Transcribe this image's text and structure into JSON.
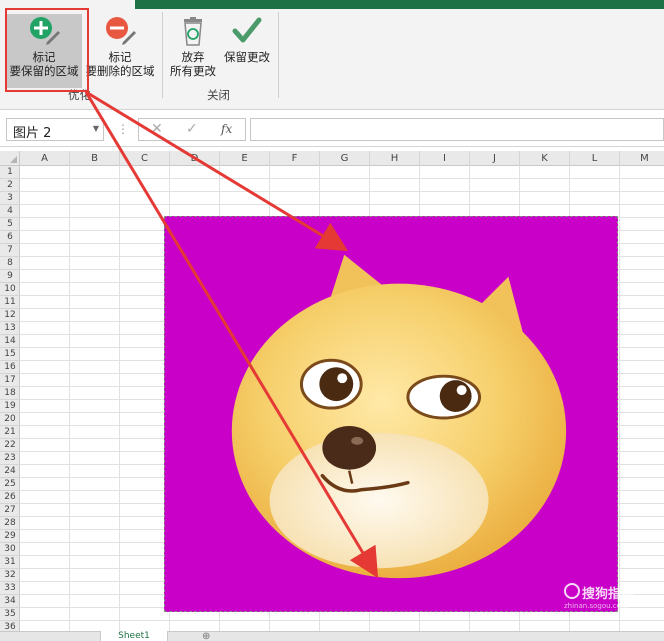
{
  "ribbon": {
    "keep_button": {
      "line1": "标记",
      "line2": "要保留的区域"
    },
    "remove_button": {
      "line1": "标记",
      "line2": "要删除的区域"
    },
    "discard_button": {
      "line1": "放弃",
      "line2": "所有更改"
    },
    "save_button": {
      "line1": "保留更改"
    },
    "group_refine": "优化",
    "group_close": "关闭"
  },
  "formula_bar": {
    "name_box": "图片 2",
    "fx": "fx",
    "value": ""
  },
  "grid": {
    "columns": [
      "A",
      "B",
      "C",
      "D",
      "E",
      "F",
      "G",
      "H",
      "I",
      "J",
      "K",
      "L",
      "M"
    ],
    "rows": [
      "1",
      "2",
      "3",
      "4",
      "5",
      "6",
      "7",
      "8",
      "9",
      "10",
      "11",
      "12",
      "13",
      "14",
      "15",
      "16",
      "17",
      "18",
      "19",
      "20",
      "21",
      "22",
      "23",
      "24",
      "25",
      "26",
      "27",
      "28",
      "29",
      "30",
      "31",
      "32",
      "33",
      "34",
      "35",
      "36"
    ]
  },
  "sheet_bar": {
    "tab": "Sheet1"
  },
  "watermark": {
    "text": "搜狗指南",
    "sub": "zhinan.sogou.com"
  },
  "colors": {
    "excel_green": "#1e7145",
    "highlight_red": "#e53935",
    "picture_bg": "#c800c8",
    "keep_icon": "#21a366",
    "remove_icon": "#e8573f"
  }
}
